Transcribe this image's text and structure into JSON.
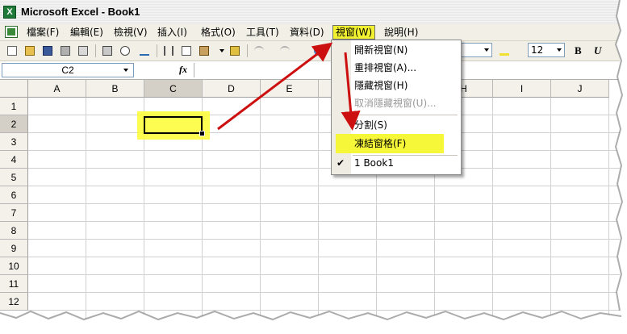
{
  "window": {
    "title": "Microsoft Excel - Book1",
    "app_icon_glyph": "X"
  },
  "menubar": {
    "items": [
      {
        "label": "檔案(F)"
      },
      {
        "label": "編輯(E)"
      },
      {
        "label": "檢視(V)"
      },
      {
        "label": "插入(I)"
      },
      {
        "label": "格式(O)"
      },
      {
        "label": "工具(T)"
      },
      {
        "label": "資料(D)"
      },
      {
        "label": "視窗(W)"
      },
      {
        "label": "說明(H)"
      }
    ]
  },
  "toolbar": {
    "font_size": "12",
    "bold_label": "B",
    "italic_label": "U"
  },
  "formula_bar": {
    "name_box": "C2",
    "fx_label": "fx",
    "formula": ""
  },
  "columns": [
    "A",
    "B",
    "C",
    "D",
    "E",
    "F",
    "G",
    "H",
    "I",
    "J"
  ],
  "rows": [
    "1",
    "2",
    "3",
    "4",
    "5",
    "6",
    "7",
    "8",
    "9",
    "10",
    "11",
    "12"
  ],
  "window_menu": {
    "items": [
      {
        "label": "開新視窗(N)",
        "enabled": true
      },
      {
        "label": "重排視窗(A)...",
        "enabled": true
      },
      {
        "label": "隱藏視窗(H)",
        "enabled": true
      },
      {
        "label": "取消隱藏視窗(U)...",
        "enabled": false
      },
      {
        "label": "分割(S)",
        "enabled": true
      },
      {
        "label": "凍結窗格(F)",
        "enabled": true,
        "highlighted": true
      },
      {
        "label": "1 Book1",
        "enabled": true,
        "checked": true
      }
    ]
  },
  "colors": {
    "highlight": "#f7f73a",
    "arrow": "#cc1010",
    "menu_bg": "#f1efe6"
  }
}
